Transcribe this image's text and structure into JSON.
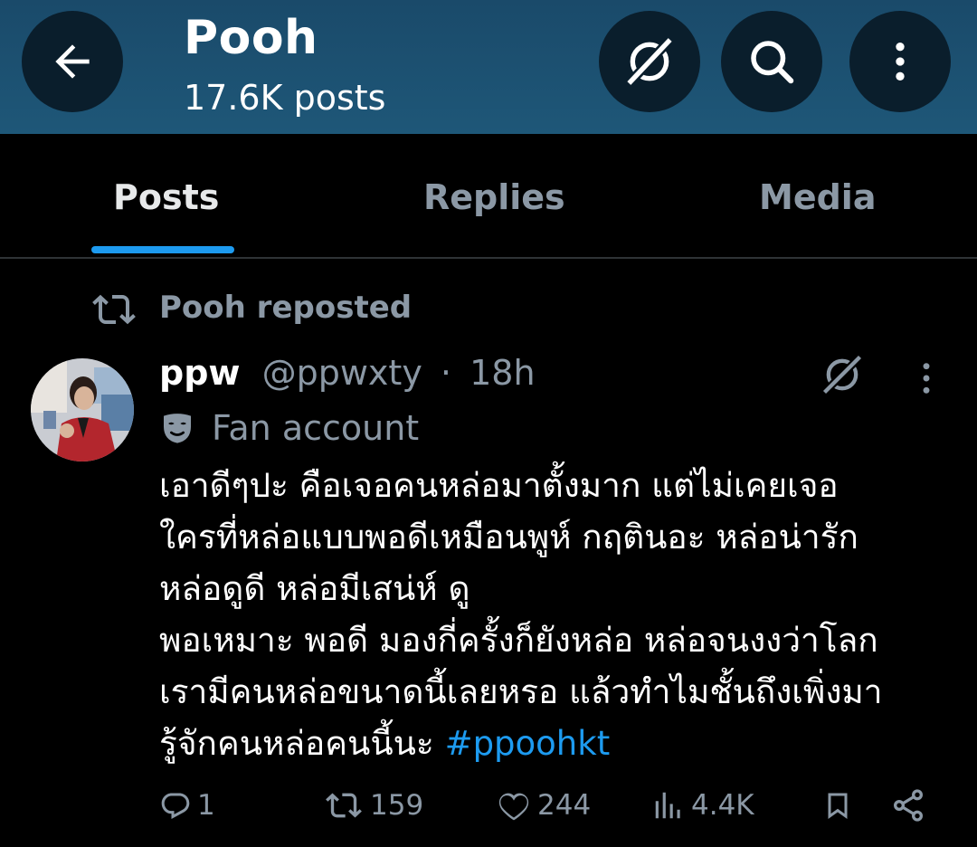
{
  "header": {
    "profile_name": "Pooh",
    "post_count": "17.6K posts",
    "back_icon": "arrow-left-icon",
    "no_animation_icon": "no-animation-icon",
    "search_icon": "search-icon",
    "more_icon": "more-vertical-icon",
    "background_color": "#1e5778"
  },
  "tabs": [
    {
      "label": "Posts",
      "active": true
    },
    {
      "label": "Replies",
      "active": false
    },
    {
      "label": "Media",
      "active": false
    }
  ],
  "accent_color": "#1d9bf0",
  "repost": {
    "icon": "repost-icon",
    "text": "Pooh reposted"
  },
  "tweet": {
    "author_name": "ppw",
    "author_handle": "@ppwxty",
    "separator": "·",
    "time": "18h",
    "label_icon": "mask-icon",
    "label_text": "Fan account",
    "body_lines": [
      "เอาดีๆปะ คือเจอคนหล่อมาตั้งมาก แต่ไม่เคยเจอ",
      "ใครที่หล่อแบบพอดีเหมือนพูห์ กฤตินอะ หล่อน่ารัก",
      "หล่อดูดี หล่อมีเสน่ห์ ดู",
      "พอเหมาะ พอดี มองกี่ครั้งก็ยังหล่อ หล่อจนงงว่าโลก",
      "เรามีคนหล่อขนาดนี้เลยหรอ แล้วทำไมชั้นถึงเพิ่งมา"
    ],
    "body_last_line": "รู้จักคนหล่อคนนี้นะ ",
    "hashtag": "#ppoohkt",
    "stats": {
      "replies": "1",
      "reposts": "159",
      "likes": "244",
      "views": "4.4K"
    }
  }
}
